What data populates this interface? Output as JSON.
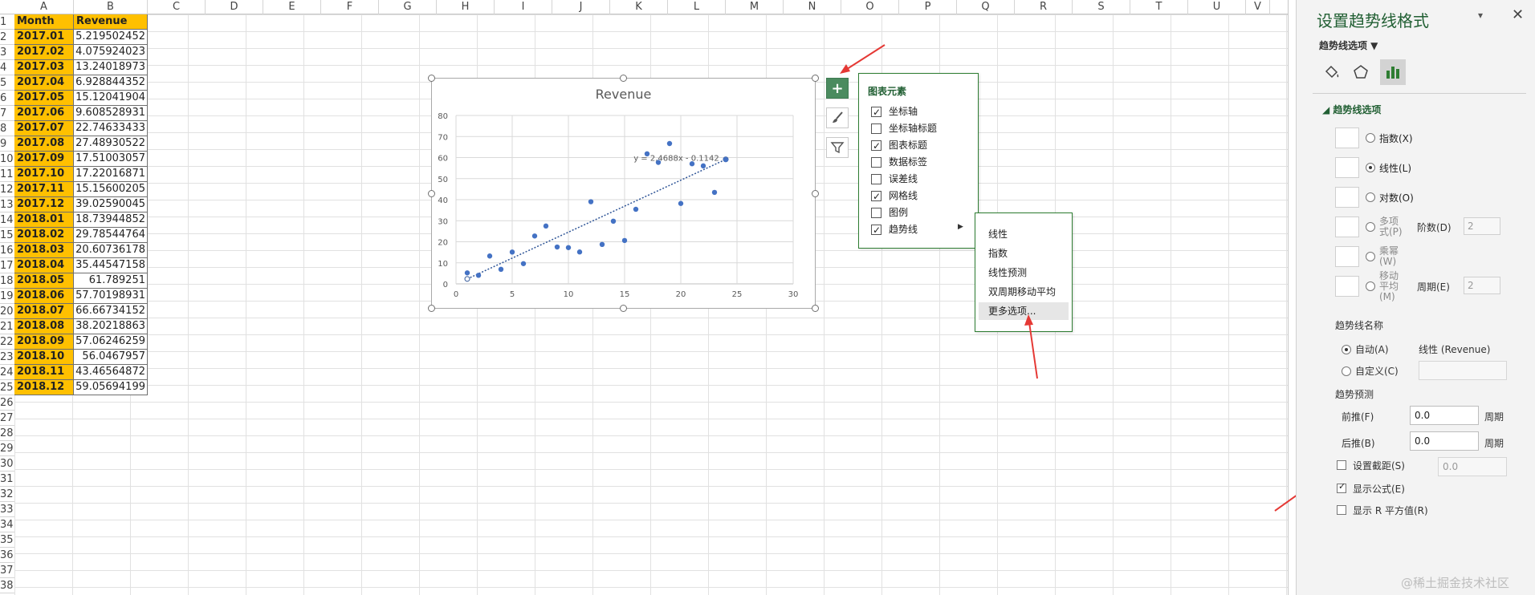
{
  "sheet": {
    "columns": [
      "A",
      "B",
      "C",
      "D",
      "E",
      "F",
      "G",
      "H",
      "I",
      "J",
      "K",
      "L",
      "M",
      "N",
      "O",
      "P",
      "Q",
      "R",
      "S",
      "T",
      "U",
      "V"
    ],
    "rows": [
      "1",
      "2",
      "3",
      "4",
      "5",
      "6",
      "7",
      "8",
      "9",
      "10",
      "11",
      "12",
      "13",
      "14",
      "15",
      "16",
      "17",
      "18",
      "19",
      "20",
      "21",
      "22",
      "23",
      "24",
      "25",
      "26",
      "27",
      "28",
      "29",
      "30",
      "31",
      "32",
      "33",
      "34",
      "35",
      "36",
      "37",
      "38"
    ],
    "header": {
      "month": "Month",
      "revenue": "Revenue"
    },
    "data": [
      [
        "2017.01",
        "5.219502452"
      ],
      [
        "2017.02",
        "4.075924023"
      ],
      [
        "2017.03",
        "13.24018973"
      ],
      [
        "2017.04",
        "6.928844352"
      ],
      [
        "2017.05",
        "15.12041904"
      ],
      [
        "2017.06",
        "9.608528931"
      ],
      [
        "2017.07",
        "22.74633433"
      ],
      [
        "2017.08",
        "27.48930522"
      ],
      [
        "2017.09",
        "17.51003057"
      ],
      [
        "2017.10",
        "17.22016871"
      ],
      [
        "2017.11",
        "15.15600205"
      ],
      [
        "2017.12",
        "39.02590045"
      ],
      [
        "2018.01",
        "18.73944852"
      ],
      [
        "2018.02",
        "29.78544764"
      ],
      [
        "2018.03",
        "20.60736178"
      ],
      [
        "2018.04",
        "35.44547158"
      ],
      [
        "2018.05",
        "61.789251"
      ],
      [
        "2018.06",
        "57.70198931"
      ],
      [
        "2018.07",
        "66.66734152"
      ],
      [
        "2018.08",
        "38.20218863"
      ],
      [
        "2018.09",
        "57.06246259"
      ],
      [
        "2018.10",
        "56.0467957"
      ],
      [
        "2018.11",
        "43.46564872"
      ],
      [
        "2018.12",
        "59.05694199"
      ]
    ]
  },
  "chart_data": {
    "type": "scatter",
    "title": "Revenue",
    "x": [
      1,
      2,
      3,
      4,
      5,
      6,
      7,
      8,
      9,
      10,
      11,
      12,
      13,
      14,
      15,
      16,
      17,
      18,
      19,
      20,
      21,
      22,
      23,
      24
    ],
    "y": [
      5.2195,
      4.0759,
      13.2402,
      6.9288,
      15.1204,
      9.6085,
      22.7463,
      27.4893,
      17.51,
      17.2202,
      15.156,
      39.0259,
      18.7394,
      29.7854,
      20.6074,
      35.4455,
      61.7893,
      57.702,
      66.6673,
      38.2022,
      57.0625,
      56.0468,
      43.4656,
      59.0569
    ],
    "xlim": [
      0,
      30
    ],
    "ylim": [
      0,
      80
    ],
    "xticks": [
      "0",
      "5",
      "10",
      "15",
      "20",
      "25",
      "30"
    ],
    "yticks": [
      "0",
      "10",
      "20",
      "30",
      "40",
      "50",
      "60",
      "70",
      "80"
    ],
    "grid": true,
    "trendline": {
      "type": "linear",
      "slope": 2.4688,
      "intercept": -0.1142,
      "equation": "y = 2.4688x - 0.1142",
      "color": "#2f5597"
    },
    "marker_color": "#4472c4"
  },
  "chart_buttons": {
    "plus": "+",
    "brush": "brush-icon",
    "filter": "filter-icon"
  },
  "elements_panel": {
    "title": "图表元素",
    "items": [
      {
        "label": "坐标轴",
        "checked": true
      },
      {
        "label": "坐标轴标题",
        "checked": false
      },
      {
        "label": "图表标题",
        "checked": true
      },
      {
        "label": "数据标签",
        "checked": false
      },
      {
        "label": "误差线",
        "checked": false
      },
      {
        "label": "网格线",
        "checked": true
      },
      {
        "label": "图例",
        "checked": false
      },
      {
        "label": "趋势线",
        "checked": true
      }
    ],
    "submenu_arrow": "▶"
  },
  "trend_menu": [
    "线性",
    "指数",
    "线性预测",
    "双周期移动平均",
    "更多选项..."
  ],
  "pane": {
    "title": "设置趋势线格式",
    "collapse": "▾",
    "close": "✕",
    "subtitle": "趋势线选项 ▼",
    "section": "◢ 趋势线选项",
    "options": [
      {
        "label": "指数(X)",
        "selected": false
      },
      {
        "label": "线性(L)",
        "selected": true
      },
      {
        "label": "对数(O)",
        "selected": false
      },
      {
        "label": "多项式(P)",
        "selected": false,
        "extra_label": "阶数(D)",
        "extra_value": "2"
      },
      {
        "label": "乘幂(W)",
        "selected": false
      },
      {
        "label": "移动平均(M)",
        "selected": false,
        "extra_label": "周期(E)",
        "extra_value": "2"
      }
    ],
    "name_title": "趋势线名称",
    "name_auto": "自动(A)",
    "name_auto_value": "线性 (Revenue)",
    "name_custom": "自定义(C)",
    "forecast_title": "趋势预测",
    "forward_label": "前推(F)",
    "forward_value": "0.0",
    "backward_label": "后推(B)",
    "backward_value": "0.0",
    "period_unit": "周期",
    "intercept_label": "设置截距(S)",
    "intercept_value": "0.0",
    "show_equation": "显示公式(E)",
    "show_r2": "显示 R 平方值(R)"
  },
  "watermark": "@稀土掘金技术社区"
}
